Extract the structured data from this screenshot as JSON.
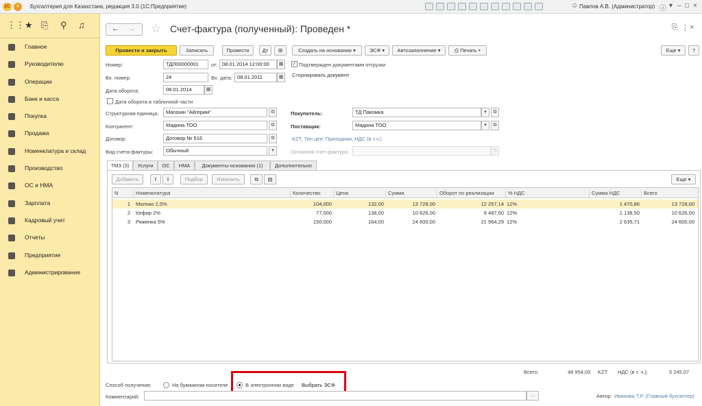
{
  "app": {
    "logo": "1С",
    "title": "Бухгалтерия для Казахстана, редакция 3.0  (1С:Предприятие)",
    "user": "Павлов А.В. (Администратор)"
  },
  "sidebar": {
    "items": [
      {
        "label": "Главное",
        "icon": "menu-icon"
      },
      {
        "label": "Руководителю",
        "icon": "chart-line-icon"
      },
      {
        "label": "Операции",
        "icon": "operations-icon"
      },
      {
        "label": "Банк и касса",
        "icon": "coins-icon"
      },
      {
        "label": "Покупка",
        "icon": "cart-icon"
      },
      {
        "label": "Продажа",
        "icon": "bag-icon"
      },
      {
        "label": "Номенклатура и склад",
        "icon": "grid-icon"
      },
      {
        "label": "Производство",
        "icon": "factory-icon"
      },
      {
        "label": "ОС и НМА",
        "icon": "truck-icon"
      },
      {
        "label": "Зарплата",
        "icon": "money-icon"
      },
      {
        "label": "Кадровый учет",
        "icon": "people-icon"
      },
      {
        "label": "Отчеты",
        "icon": "bar-chart-icon"
      },
      {
        "label": "Предприятие",
        "icon": "building-icon"
      },
      {
        "label": "Администрирование",
        "icon": "gear-icon"
      }
    ]
  },
  "doc": {
    "title": "Счет-фактура (полученный): Проведен *"
  },
  "toolbar": {
    "post_close": "Провести и закрыть",
    "save": "Записать",
    "post": "Провести",
    "create_based": "Создать на основании",
    "esf": "ЭСФ",
    "autofill": "Автозаполнение",
    "print": "Печать",
    "more": "Еще"
  },
  "form": {
    "number_label": "Номер:",
    "number": "ТДЛ00000001",
    "from_label": "от:",
    "from_date": "08.01.2014 12:00:00",
    "confirm_label": "Подтвержден документами отгрузки",
    "confirm_checked": true,
    "in_number_label": "Вх. номер:",
    "in_number": "24",
    "in_date_label": "Вх. дата:",
    "in_date": "08.01.2011",
    "reverse_link": "Сторнировать документ",
    "turnover_date_label": "Дата оборота:",
    "turnover_date": "08.01.2014",
    "turnover_table_label": "Дата оборота в табличной части",
    "unit_label": "Структурная единица:",
    "unit": "Магазин \"Айгерим\"",
    "buyer_label": "Покупатель:",
    "buyer": "ТД Пакомка",
    "counterparty_label": "Контрагент:",
    "counterparty": "Мадина ТОО",
    "supplier_label": "Поставщик:",
    "supplier": "Мадина ТОО",
    "contract_label": "Договор:",
    "contract": "Договор № 516",
    "contract_info": "KZT, Тип цен: Приходная, НДС (в т.ч.)",
    "invoice_type_label": "Вид счета-фактуры:",
    "invoice_type": "Обычный",
    "base_invoice_label": "Основной счет-фактура:"
  },
  "tabs": [
    "ТМЗ (3)",
    "Услуги",
    "ОС",
    "НМА",
    "Документы-основания (1)",
    "Дополнительно"
  ],
  "table_toolbar": {
    "add": "Добавить",
    "pick": "Подбор",
    "change": "Изменить",
    "more": "Еще"
  },
  "table": {
    "columns": [
      "N",
      "Номенклатура",
      "Количество",
      "Цена",
      "Сумма",
      "Оборот по реализации",
      "% НДС",
      "Сумма НДС",
      "Всего"
    ],
    "rows": [
      [
        "1",
        "Молоко 2,5%",
        "104,000",
        "132,00",
        "13 728,00",
        "12 257,14",
        "12%",
        "1 470,86",
        "13 728,00"
      ],
      [
        "2",
        "Кефир 2%",
        "77,000",
        "138,00",
        "10 626,00",
        "9 487,50",
        "12%",
        "1 138,50",
        "10 626,00"
      ],
      [
        "3",
        "Ряженка 5%",
        "150,000",
        "164,00",
        "24 600,00",
        "21 964,29",
        "12%",
        "2 635,71",
        "24 600,00"
      ]
    ]
  },
  "totals": {
    "total_label": "Всего:",
    "total": "48 954,00",
    "currency": "KZT",
    "vat_label": "НДС (в т. ч.):",
    "vat": "5 245,07"
  },
  "receipt": {
    "label": "Способ получения:",
    "paper": "На бумажном носителе",
    "electronic": "В электронном виде",
    "choose_esf": "Выбрать ЭСФ"
  },
  "comment": {
    "label": "Комментарий:",
    "value": "",
    "dots": "..."
  },
  "author": {
    "label": "Автор:",
    "name": "Иванова Т.Р. (Главный бухгалтер)"
  }
}
